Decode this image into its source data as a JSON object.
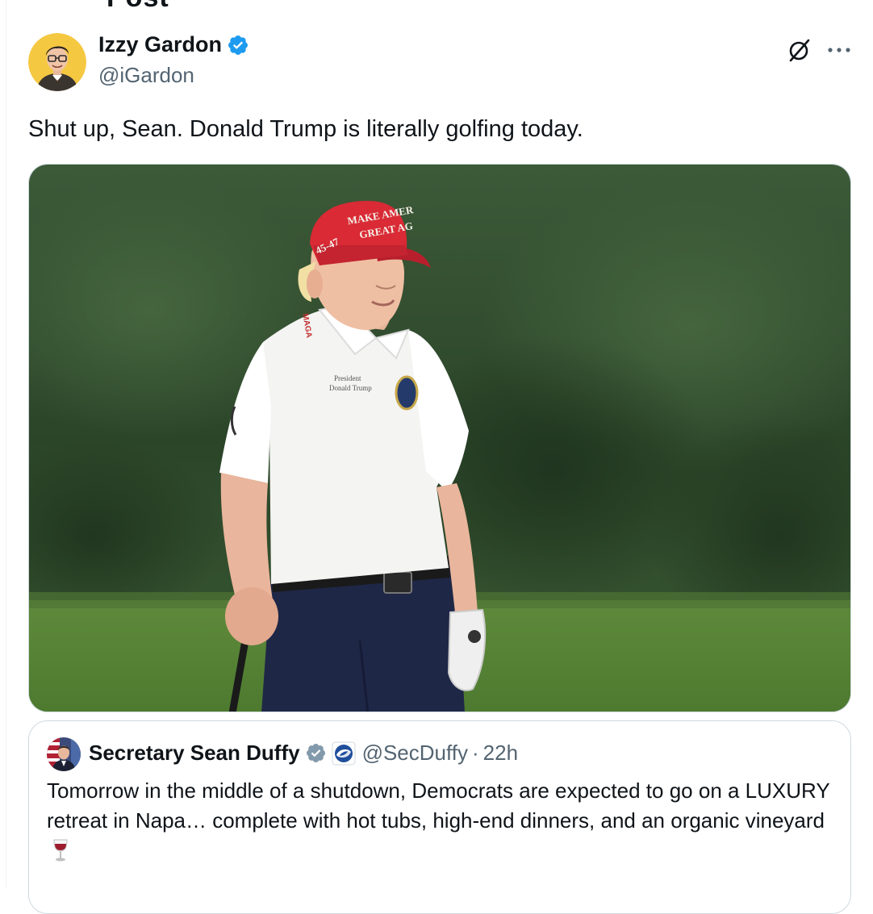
{
  "header": {
    "partial_title": "Post"
  },
  "tweet": {
    "author_name": "Izzy Gardon",
    "author_handle": "@iGardon",
    "text": "Shut up, Sean. Donald Trump is literally golfing today.",
    "media": {
      "cap_text_line1": "MAKE AMER",
      "cap_text_line2": "GREAT AG",
      "cap_side_text": "45-47",
      "collar_text": "MAGA",
      "shirt_text_line1": "President",
      "shirt_text_line2": "Donald Trump"
    }
  },
  "quote": {
    "author_name": "Secretary Sean Duffy",
    "author_handle": "@SecDuffy",
    "separator": "·",
    "time": "22h",
    "text": "Tomorrow in the middle of a shutdown, Democrats are expected to go on a LUXURY retreat in Napa… complete with hot tubs, high-end dinners, and an organic vineyard"
  },
  "icons": {
    "verified": "verified-badge-icon",
    "gov_verified": "gray-verified-badge-icon",
    "affiliation": "dot-logo-icon",
    "grok": "grok-icon",
    "more": "more-icon",
    "wine": "wine-glass-icon"
  },
  "colors": {
    "verified_blue": "#1d9bf0",
    "gov_gray": "#829aab",
    "muted": "#536471",
    "text": "#0f1419",
    "border": "#cfd9de"
  }
}
